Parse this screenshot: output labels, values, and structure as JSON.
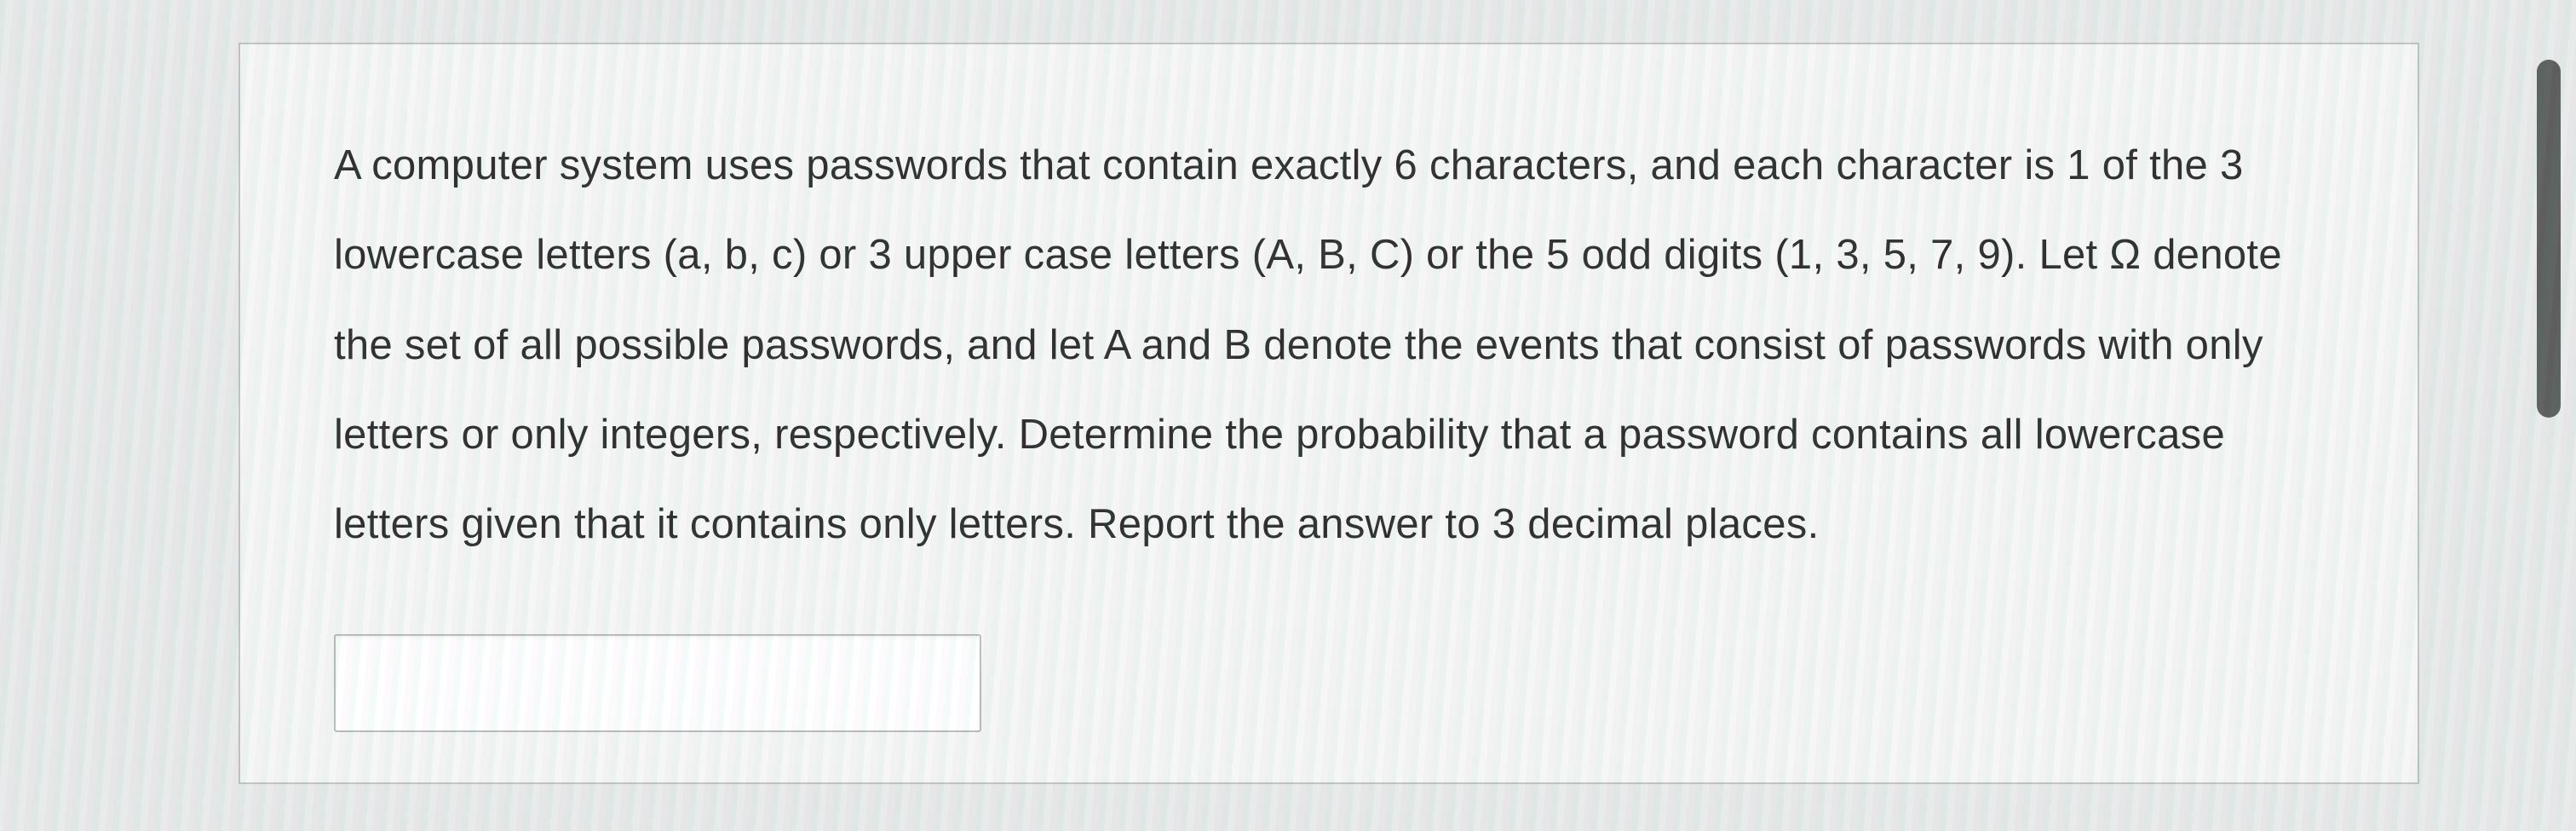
{
  "question": {
    "text": "A computer system uses passwords that contain exactly 6 characters,  and each character is 1 of the 3 lowercase letters (a, b, c) or 3 upper case letters (A, B, C) or the 5 odd digits (1, 3, 5, 7, 9). Let Ω denote the set of all possible passwords, and let A and B denote the events that consist of passwords with only letters or only integers, respectively. Determine the probability that a password contains all lowercase letters given that it contains only letters. Report the answer to 3 decimal places."
  },
  "answer": {
    "value": "",
    "placeholder": ""
  }
}
